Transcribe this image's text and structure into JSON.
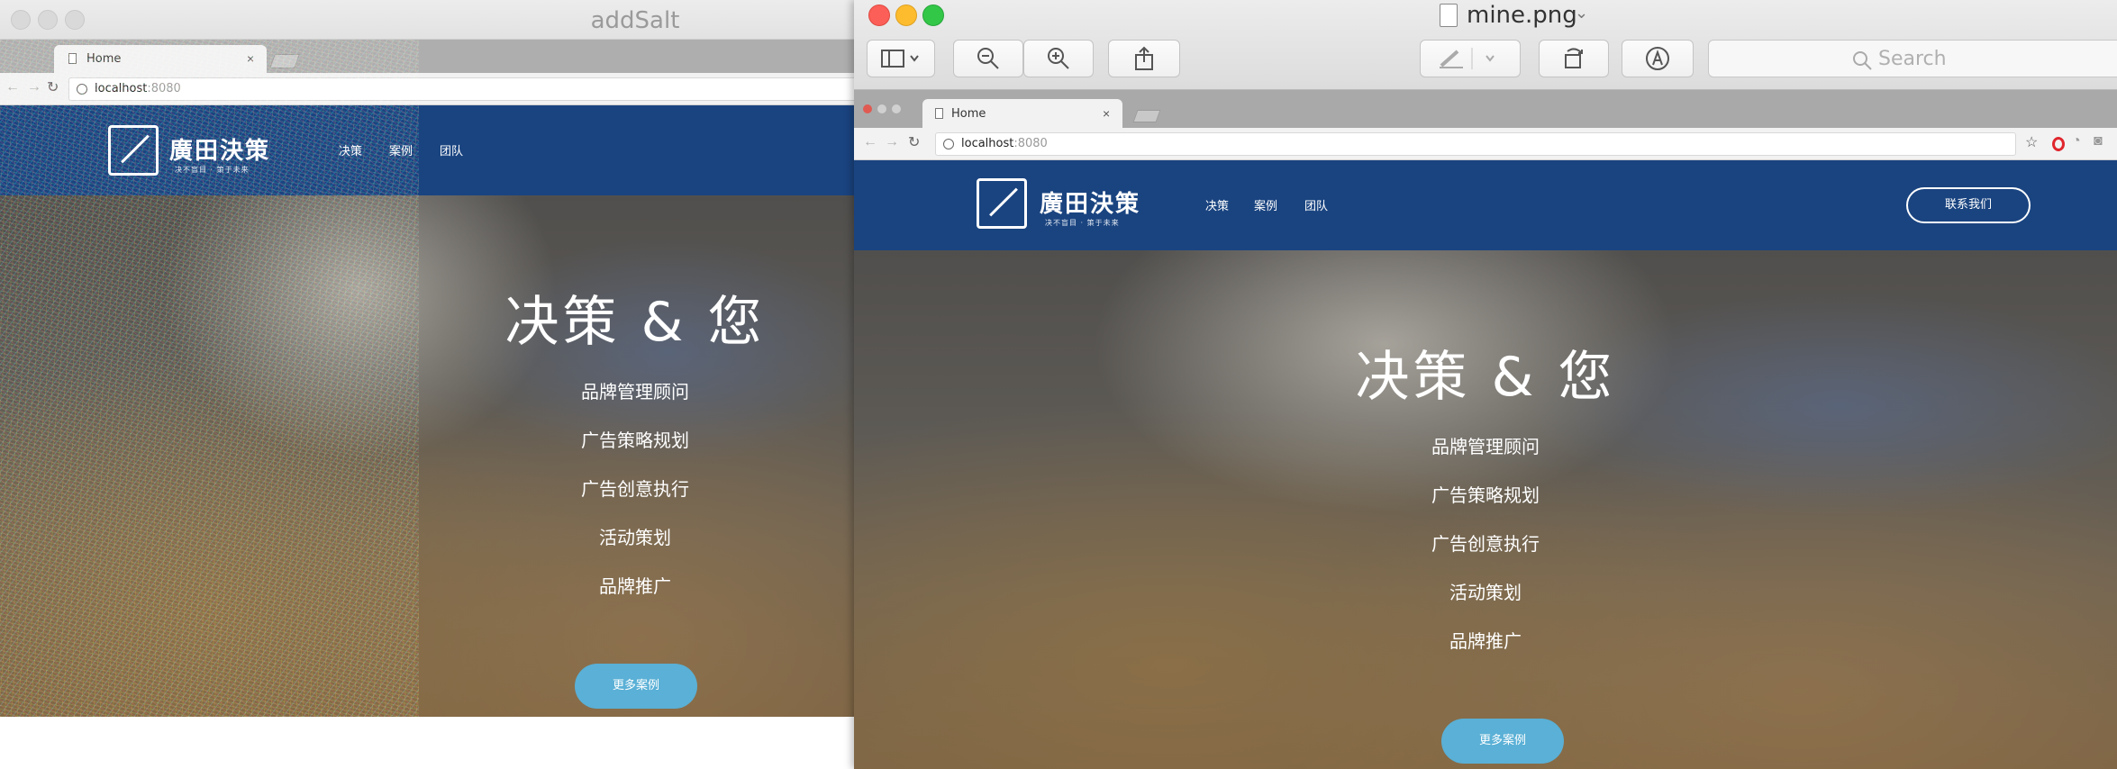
{
  "left_window": {
    "title": "addSalt",
    "browser": {
      "tab_label": "Home",
      "tab_close": "×",
      "url_host": "localhost",
      "url_port": ":8080"
    },
    "site": {
      "logo_text": "廣田決策",
      "logo_sub": "决不盲目 · 策于未来",
      "nav": [
        "决策",
        "案例",
        "团队"
      ],
      "hero_title": "决策 & 您",
      "services": [
        "品牌管理顾问",
        "广告策略规划",
        "广告创意执行",
        "活动策划",
        "品牌推广"
      ],
      "cta": "更多案例"
    }
  },
  "right_window": {
    "file_title": "mine.png",
    "search_placeholder": "Search",
    "browser": {
      "tab_label": "Home",
      "tab_close": "×",
      "url_host": "localhost",
      "url_port": ":8080"
    },
    "site": {
      "logo_text": "廣田決策",
      "logo_sub": "决不盲目 · 策于未来",
      "nav": [
        "决策",
        "案例",
        "团队"
      ],
      "contact": "联系我们",
      "hero_title": "决策 & 您",
      "services": [
        "品牌管理顾问",
        "广告策略规划",
        "广告创意执行",
        "活动策划",
        "品牌推广"
      ],
      "cta": "更多案例"
    }
  },
  "colors": {
    "site_header": "#1a4480",
    "cta_button": "#5ab0d6",
    "traffic_red": "#fc5f57",
    "traffic_yellow": "#fdbc2e",
    "traffic_green": "#33c748"
  }
}
